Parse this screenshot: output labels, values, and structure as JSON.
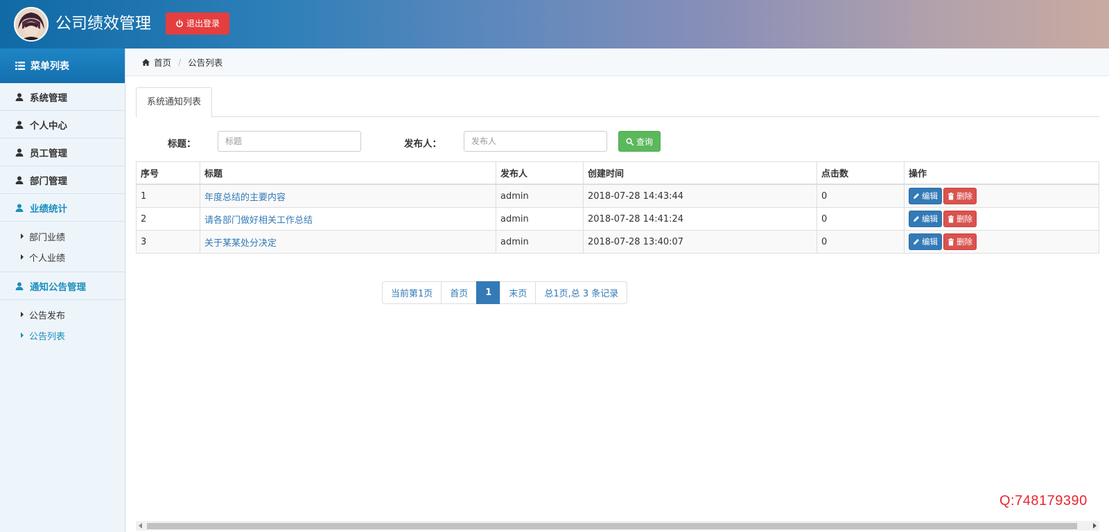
{
  "header": {
    "app_title": "公司绩效管理",
    "logout_label": "退出登录"
  },
  "sidebar": {
    "menu_title": "菜单列表",
    "items": [
      {
        "label": "系统管理"
      },
      {
        "label": "个人中心"
      },
      {
        "label": "员工管理"
      },
      {
        "label": "部门管理"
      },
      {
        "label": "业绩统计"
      },
      {
        "label": "通知公告管理"
      }
    ],
    "perf_sub": [
      {
        "label": "部门业绩"
      },
      {
        "label": "个人业绩"
      }
    ],
    "notice_sub": [
      {
        "label": "公告发布"
      },
      {
        "label": "公告列表"
      }
    ]
  },
  "breadcrumb": {
    "home": "首页",
    "current": "公告列表"
  },
  "main": {
    "tab_label": "系统通知列表",
    "search": {
      "title_label": "标题：",
      "title_placeholder": "标题",
      "publisher_label": "发布人：",
      "publisher_placeholder": "发布人",
      "query_label": "查询"
    },
    "table": {
      "headers": [
        "序号",
        "标题",
        "发布人",
        "创建时间",
        "点击数",
        "操作"
      ],
      "rows": [
        {
          "no": "1",
          "title": "年度总结的主要内容",
          "publisher": "admin",
          "created": "2018-07-28 14:43:44",
          "clicks": "0"
        },
        {
          "no": "2",
          "title": "请各部门做好相关工作总结",
          "publisher": "admin",
          "created": "2018-07-28 14:41:24",
          "clicks": "0"
        },
        {
          "no": "3",
          "title": "关于某某处分决定",
          "publisher": "admin",
          "created": "2018-07-28 13:40:07",
          "clicks": "0"
        }
      ],
      "edit_label": "编辑",
      "delete_label": "删除"
    },
    "pagination": {
      "current_page_text": "当前第1页",
      "first": "首页",
      "page": "1",
      "last": "末页",
      "summary": "总1页,总 3 条记录"
    }
  },
  "watermark": "Q:748179390",
  "colors": {
    "accent": "#1b8fbf",
    "logout": "#e53e3e",
    "query": "#5cb85c",
    "edit": "#337ab7",
    "delete": "#d9534f"
  }
}
